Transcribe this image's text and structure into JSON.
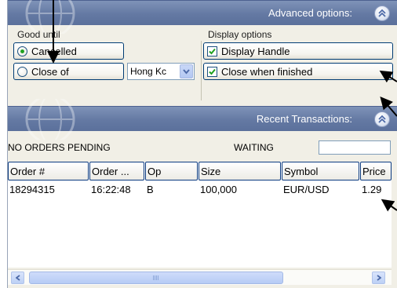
{
  "advanced_header": {
    "title": "Advanced options:",
    "toggle_icon": "chevron-up-double-icon"
  },
  "good_until": {
    "label": "Good until",
    "options": [
      {
        "label": "Cancelled",
        "selected": true
      },
      {
        "label": "Close of",
        "selected": false
      }
    ],
    "market_select": {
      "value": "Hong Kc"
    }
  },
  "display_options": {
    "label": "Display options",
    "checks": [
      {
        "label": "Display Handle",
        "checked": true
      },
      {
        "label": "Close when finished",
        "checked": true
      }
    ]
  },
  "recent_header": {
    "title": "Recent Transactions:",
    "toggle_icon": "chevron-up-double-icon"
  },
  "status": {
    "orders": "NO ORDERS PENDING",
    "state": "WAITING",
    "input_value": ""
  },
  "table": {
    "columns": [
      "Order #",
      "Order ...",
      "Op",
      "Size",
      "Symbol",
      "Price"
    ],
    "rows": [
      [
        "18294315",
        "16:22:48",
        "B",
        "100,000",
        "EUR/USD",
        "1.29"
      ]
    ]
  },
  "colors": {
    "header_blue": "#6479a3",
    "radio_green": "#21a121",
    "check_green": "#21a121",
    "border_blue": "#003c74"
  }
}
